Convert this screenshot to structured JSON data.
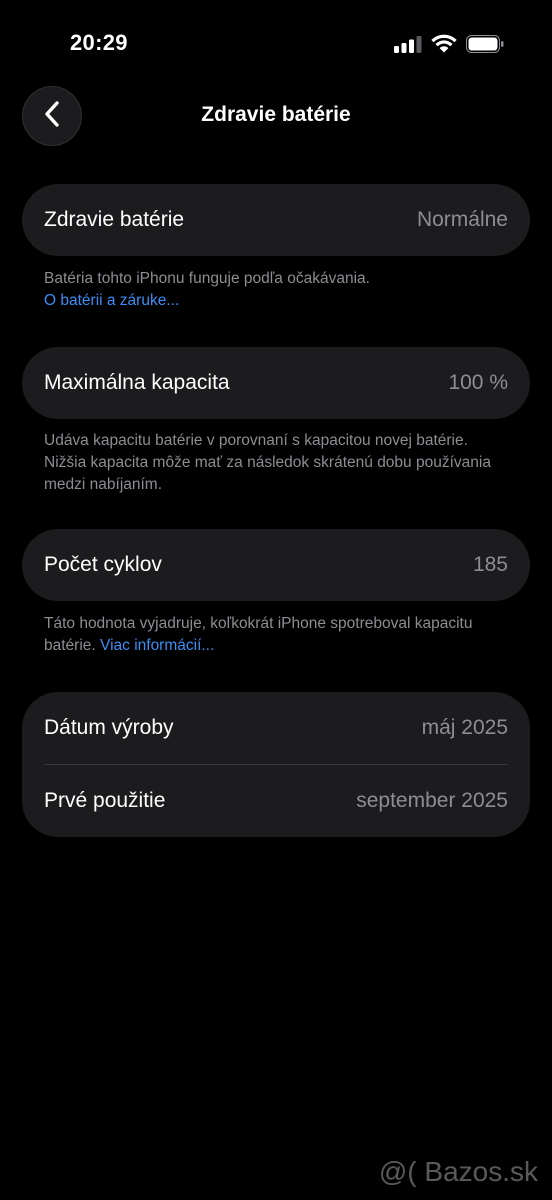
{
  "status_bar": {
    "time": "20:29"
  },
  "nav": {
    "title": "Zdravie batérie"
  },
  "battery_health": {
    "label": "Zdravie batérie",
    "value": "Normálne",
    "note": "Batéria tohto iPhonu funguje podľa očakávania.",
    "link": "O batérii a záruke..."
  },
  "max_capacity": {
    "label": "Maximálna kapacita",
    "value": "100 %",
    "note": "Udáva kapacitu batérie v porovnaní s kapacitou novej batérie. Nižšia kapacita môže mať za následok skrátenú dobu používania medzi nabíjaním."
  },
  "cycle_count": {
    "label": "Počet cyklov",
    "value": "185",
    "note": "Táto hodnota vyjadruje, koľkokrát iPhone spotreboval kapacitu batérie.",
    "link": "Viac informácií..."
  },
  "dates": {
    "manufacture_label": "Dátum výroby",
    "manufacture_value": "máj 2025",
    "first_use_label": "Prvé použitie",
    "first_use_value": "september 2025"
  },
  "watermark": "@( Bazos.sk",
  "colors": {
    "background": "#000000",
    "card": "#1c1c1e",
    "secondary_text": "#8d8d93",
    "link": "#3a8ef6"
  },
  "icons": [
    "cellular-signal-icon",
    "wifi-icon",
    "battery-icon",
    "chevron-left-icon"
  ]
}
